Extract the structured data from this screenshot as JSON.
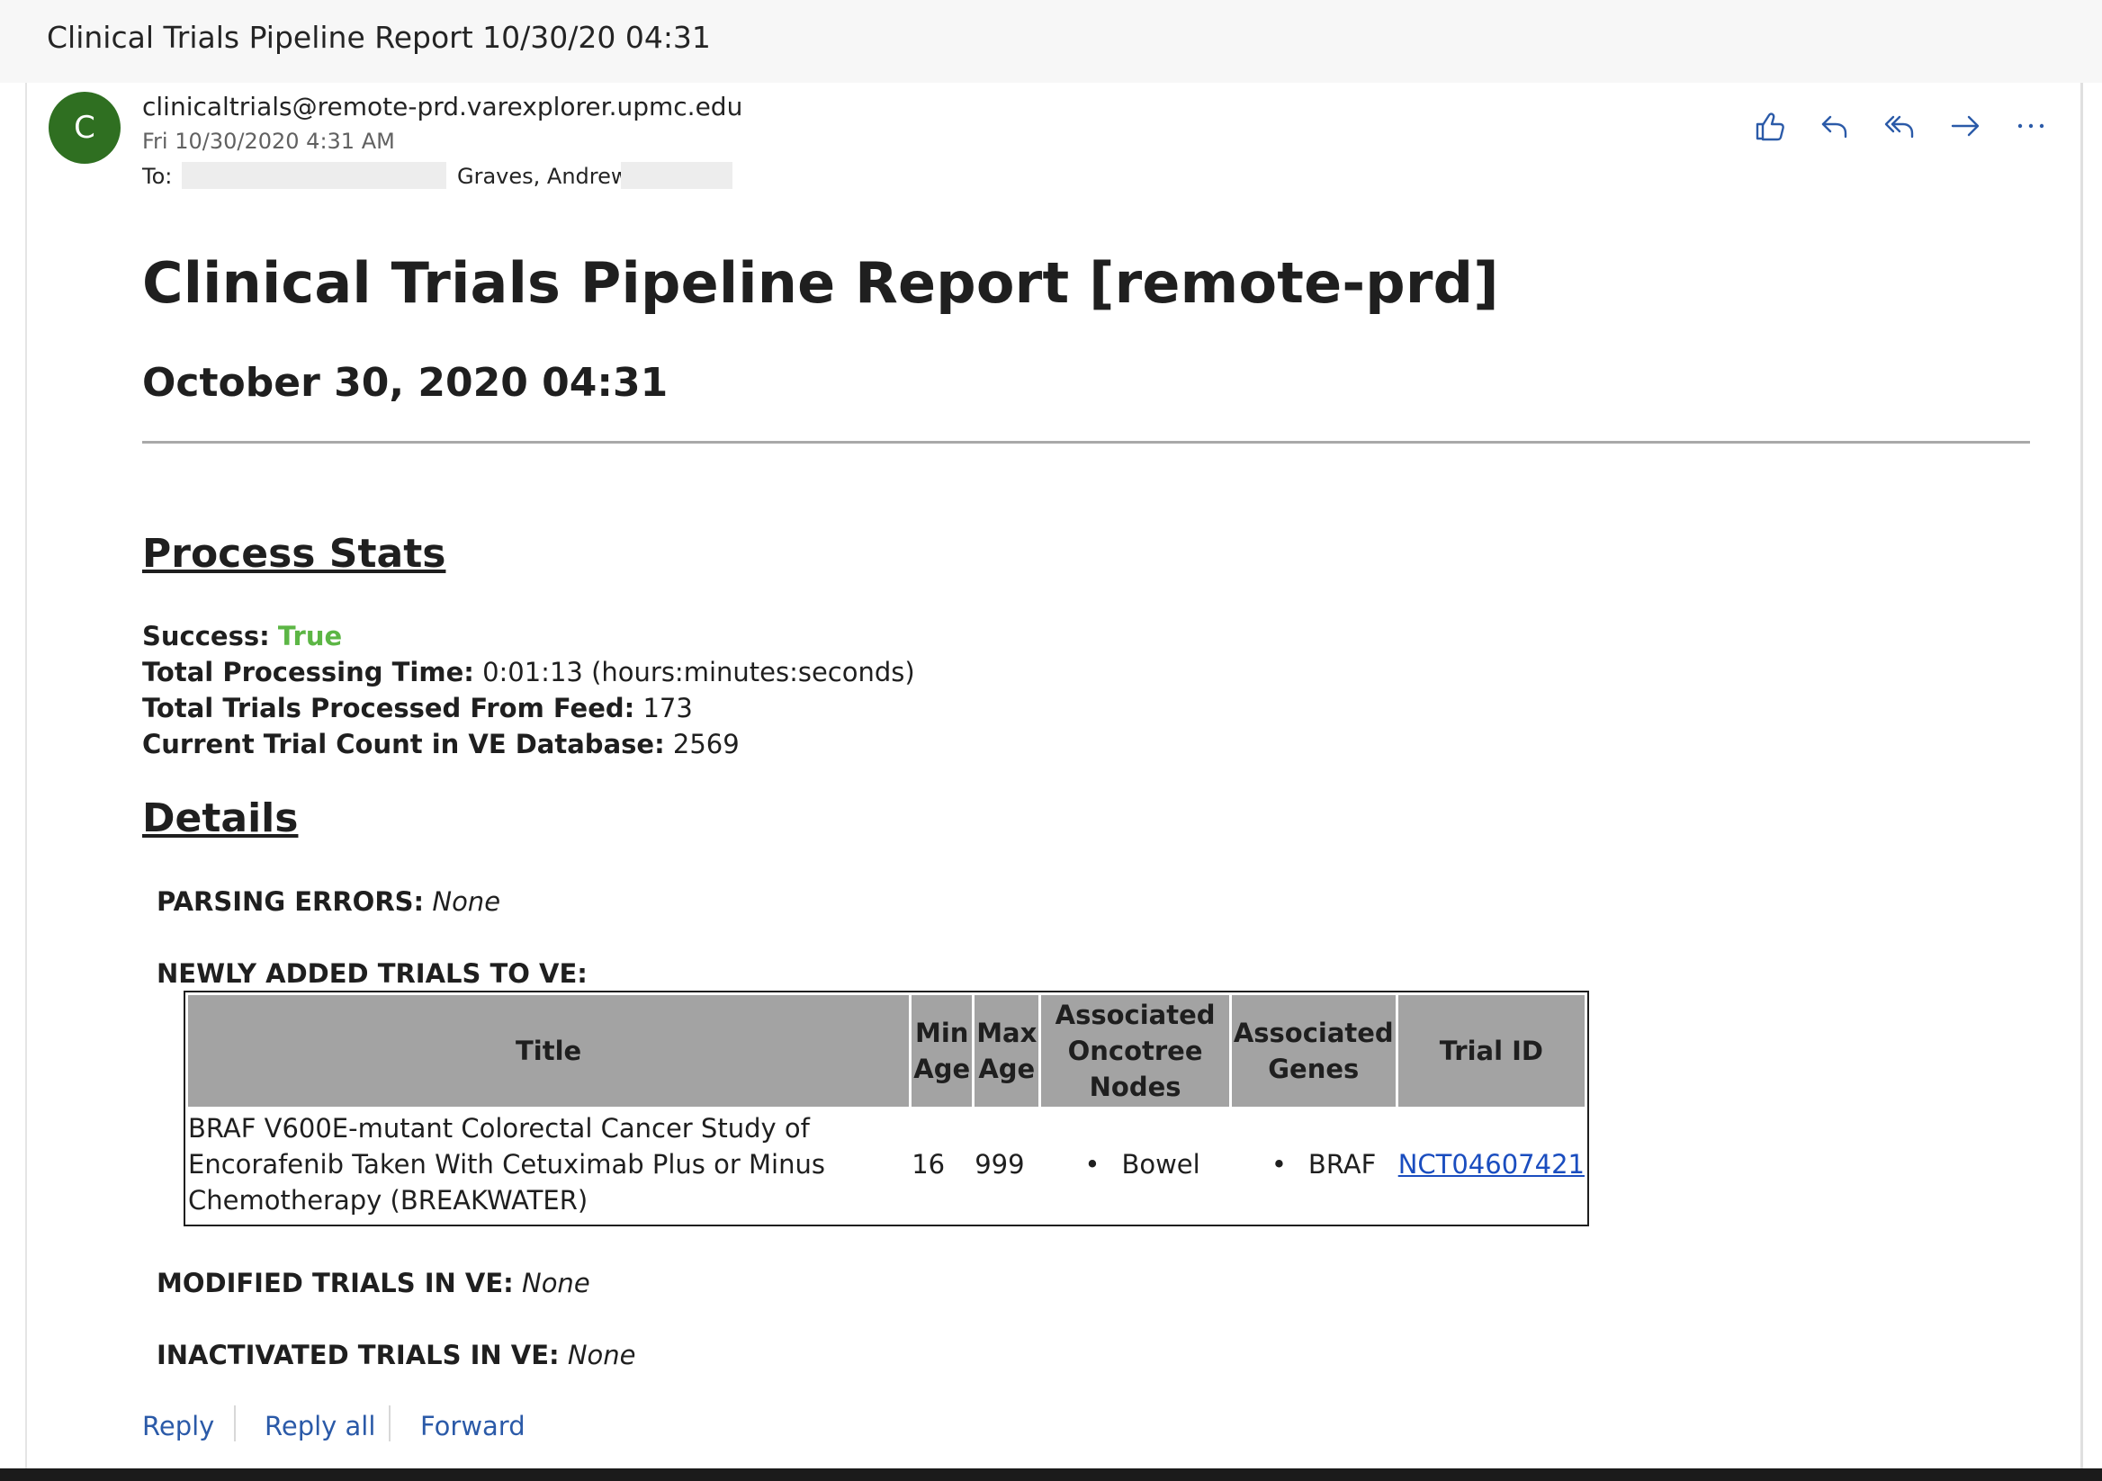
{
  "window": {
    "subject": "Clinical Trials Pipeline Report 10/30/20 04:31"
  },
  "header": {
    "avatar_letter": "C",
    "sender": "clinicaltrials@remote-prd.varexplorer.upmc.edu",
    "date": "Fri 10/30/2020 4:31 AM",
    "to_label": "To:",
    "to_visible_name": "Graves, Andrew;"
  },
  "actions": {
    "like": "like-icon",
    "reply": "reply-icon",
    "reply_all": "reply-all-icon",
    "forward": "forward-icon",
    "more": "more-icon"
  },
  "report": {
    "title": "Clinical Trials Pipeline Report [remote-prd]",
    "date": "October 30, 2020 04:31",
    "process_stats_title": "Process Stats",
    "stats": {
      "success_label": "Success:",
      "success_value": "True",
      "time_label": "Total Processing Time:",
      "time_value": "0:01:13 (hours:minutes:seconds)",
      "processed_label": "Total Trials Processed From Feed:",
      "processed_value": "173",
      "count_label": "Current Trial Count in VE Database:",
      "count_value": "2569"
    },
    "details_title": "Details",
    "parsing_label": "PARSING ERRORS:",
    "parsing_value": "None",
    "new_trials_label": "NEWLY ADDED TRIALS TO VE:",
    "table": {
      "headers": {
        "title": "Title",
        "min_age": "Min Age",
        "max_age": "Max Age",
        "nodes": "Associated Oncotree Nodes",
        "genes": "Associated Genes",
        "trial_id": "Trial ID"
      },
      "rows": [
        {
          "title": "BRAF V600E-mutant Colorectal Cancer Study of Encorafenib Taken With Cetuximab Plus or Minus Chemotherapy (BREAKWATER)",
          "min_age": "16",
          "max_age": "999",
          "node": "Bowel",
          "gene": "BRAF",
          "trial_id": "NCT04607421"
        }
      ]
    },
    "modified_label": "MODIFIED TRIALS IN VE:",
    "modified_value": "None",
    "inactivated_label": "INACTIVATED TRIALS IN VE:",
    "inactivated_value": "None"
  },
  "footer": {
    "reply": "Reply",
    "reply_all": "Reply all",
    "forward": "Forward"
  },
  "colors": {
    "accent": "#2b5aa8",
    "success": "#5cb645",
    "avatar": "#2f6f21",
    "table_header": "#a3a3a3"
  }
}
